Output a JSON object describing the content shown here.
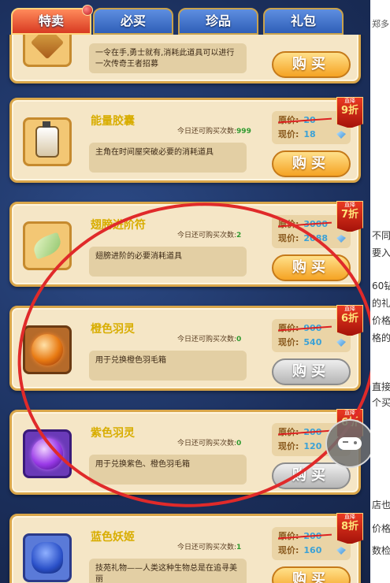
{
  "tabs": [
    {
      "label": "特卖",
      "active": true
    },
    {
      "label": "必买",
      "active": false
    },
    {
      "label": "珍品",
      "active": false
    },
    {
      "label": "礼包",
      "active": false
    }
  ],
  "items": [
    {
      "name": "",
      "limit": "",
      "desc": "一令在手,勇士就有,消耗此道具可以进行一次传奇王者招募",
      "orig_label": "",
      "orig_value": "",
      "cur_label": "",
      "cur_value": "",
      "buy_label": "购买",
      "buy_enabled": true,
      "badge": null,
      "icon": "sword-token-icon"
    },
    {
      "name": "能量胶囊",
      "limit_label": "今日还可购买次数:",
      "limit_value": "999",
      "desc": "主角在时间屋突破必要的消耗道具",
      "orig_label": "原价:",
      "orig_value": "20",
      "cur_label": "现价:",
      "cur_value": "18",
      "buy_label": "购买",
      "buy_enabled": true,
      "badge_top": "直降",
      "badge_discount": "9折",
      "icon": "energy-capsule-icon"
    },
    {
      "name": "翅膀进阶符",
      "limit_label": "今日还可购买次数:",
      "limit_value": "2",
      "desc": "翅膀进阶的必要消耗道具",
      "orig_label": "原价:",
      "orig_value": "3000",
      "cur_label": "现价:",
      "cur_value": "2088",
      "buy_label": "购买",
      "buy_enabled": true,
      "badge_top": "直降",
      "badge_discount": "7折",
      "icon": "wing-charm-icon"
    },
    {
      "name": "橙色羽灵",
      "limit_label": "今日还可购买次数:",
      "limit_value": "0",
      "desc": "用于兑换橙色羽毛箱",
      "orig_label": "原价:",
      "orig_value": "900",
      "cur_label": "现价:",
      "cur_value": "540",
      "buy_label": "购买",
      "buy_enabled": false,
      "badge_top": "直降",
      "badge_discount": "6折",
      "icon": "orange-feather-spirit-icon"
    },
    {
      "name": "紫色羽灵",
      "limit_label": "今日还可购买次数:",
      "limit_value": "0",
      "desc": "用于兑换紫色、橙色羽毛箱",
      "orig_label": "原价:",
      "orig_value": "200",
      "cur_label": "现价:",
      "cur_value": "120",
      "buy_label": "购买",
      "buy_enabled": false,
      "badge_top": "直降",
      "badge_discount": "6折",
      "icon": "purple-feather-spirit-icon"
    },
    {
      "name": "蓝色妖姬",
      "limit_label": "今日还可购买次数:",
      "limit_value": "1",
      "desc": "技苑礼物——人类这种生物总是在追寻美丽",
      "orig_label": "原价:",
      "orig_value": "200",
      "cur_label": "现价:",
      "cur_value": "160",
      "buy_label": "购买",
      "buy_enabled": true,
      "badge_top": "直降",
      "badge_discount": "8折",
      "icon": "blue-rose-icon"
    }
  ],
  "side_page": {
    "texts": [
      "郑多",
      "不同",
      "要入",
      "60钻",
      "的礼",
      "价格",
      "格的",
      "直接",
      "个买",
      "店也",
      "价格",
      "数检"
    ]
  },
  "colors": {
    "annotation_circle": "#e02a2a",
    "card_border": "#d9a64a",
    "item_name": "#d8ad00",
    "price_value": "#3ba1d6",
    "badge_red": "#d22a14"
  }
}
